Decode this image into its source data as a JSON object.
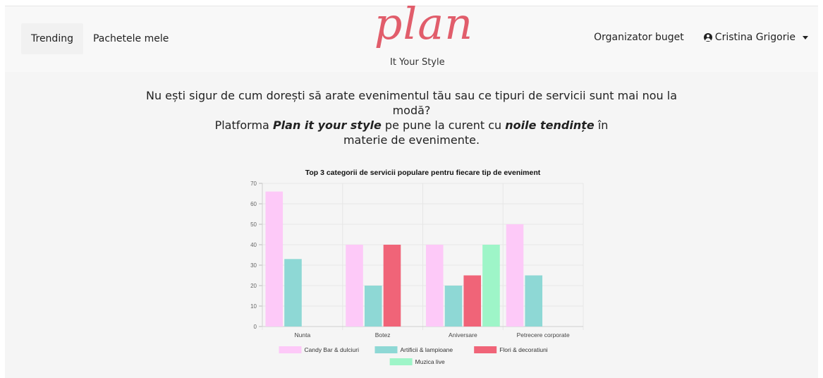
{
  "nav": {
    "trending": "Trending",
    "packages": "Pachetele mele",
    "budget": "Organizator buget",
    "user": "Cristina Grigorie"
  },
  "brand": {
    "script": "plan",
    "tagline": "It Your Style"
  },
  "intro": {
    "line1": "Nu ești sigur de cum dorești să arate evenimentul tău sau ce tipuri de servicii sunt mai nou la modă?",
    "line2_before": "Platforma ",
    "line2_brand": "Plan it your style",
    "line2_middle": " pe pune la curent cu ",
    "line2_emph": "noile tendințe",
    "line2_after": " în materie de evenimente."
  },
  "chart_data": {
    "type": "bar",
    "title": "Top 3 categorii de servicii populare pentru fiecare tip de eveniment",
    "categories": [
      "Nunta",
      "Botez",
      "Aniversare",
      "Petrecere corporate"
    ],
    "series": [
      {
        "name": "Candy Bar & dulciuri",
        "color": "#fdc9f8",
        "values": [
          66,
          40,
          40,
          50
        ]
      },
      {
        "name": "Artificii & lampioane",
        "color": "#8ed8d5",
        "values": [
          33,
          20,
          20,
          25
        ]
      },
      {
        "name": "Flori & decoratiuni",
        "color": "#f06478",
        "values": [
          0,
          40,
          25,
          0
        ]
      },
      {
        "name": "Muzica live",
        "color": "#9ef5c8",
        "values": [
          0,
          0,
          40,
          0
        ]
      }
    ],
    "ylim": [
      0,
      70
    ],
    "yticks": [
      0,
      10,
      20,
      30,
      40,
      50,
      60,
      70
    ],
    "grid": true,
    "legend": "bottom"
  }
}
